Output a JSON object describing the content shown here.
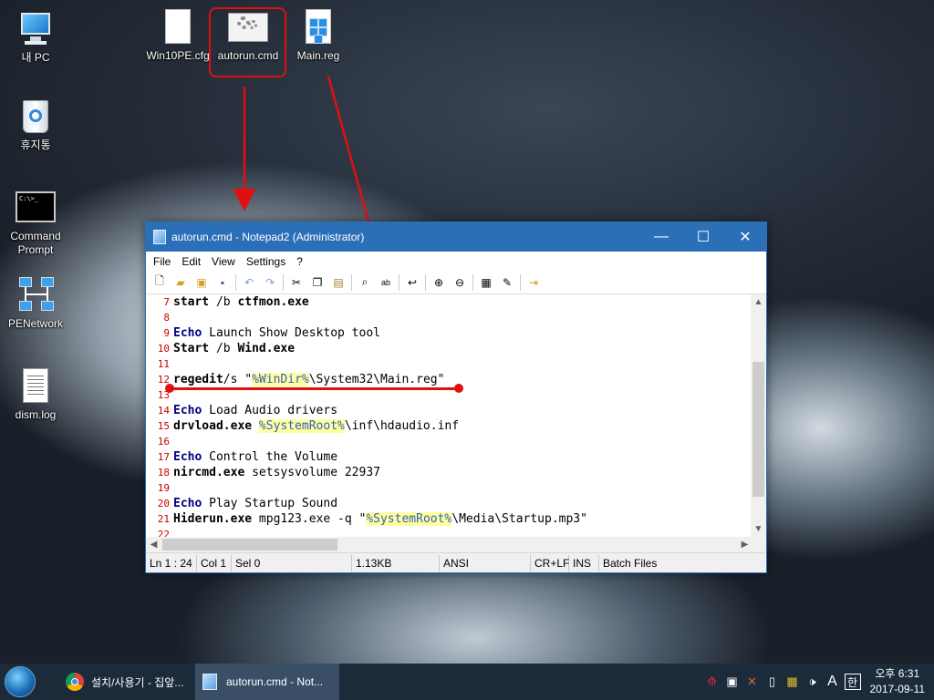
{
  "desktop": {
    "icons": [
      {
        "label": "내 PC"
      },
      {
        "label": "휴지통"
      },
      {
        "label": "Command Prompt"
      },
      {
        "label": "PENetwork"
      },
      {
        "label": "dism.log"
      },
      {
        "label": "Win10PE.cfg"
      },
      {
        "label": "autorun.cmd"
      },
      {
        "label": "Main.reg"
      }
    ]
  },
  "window": {
    "title": "autorun.cmd - Notepad2 (Administrator)",
    "menu": [
      "File",
      "Edit",
      "View",
      "Settings",
      "?"
    ],
    "lines": [
      {
        "n": "7",
        "parts": [
          {
            "t": "start",
            "c": "kw"
          },
          {
            "t": " /b ",
            "c": "code"
          },
          {
            "t": "ctfmon.exe",
            "c": "kw"
          }
        ]
      },
      {
        "n": "8",
        "parts": []
      },
      {
        "n": "9",
        "parts": [
          {
            "t": "Echo",
            "c": "echo"
          },
          {
            "t": " Launch Show Desktop tool",
            "c": "code"
          }
        ]
      },
      {
        "n": "10",
        "parts": [
          {
            "t": "Start",
            "c": "kw"
          },
          {
            "t": " /b ",
            "c": "code"
          },
          {
            "t": "Wind.exe",
            "c": "kw"
          }
        ]
      },
      {
        "n": "11",
        "parts": []
      },
      {
        "n": "12",
        "parts": [
          {
            "t": "regedit",
            "c": "kw"
          },
          {
            "t": "/s \"",
            "c": "code"
          },
          {
            "t": "%WinDir%",
            "c": "var"
          },
          {
            "t": "\\System32\\Main.reg\"",
            "c": "code"
          }
        ]
      },
      {
        "n": "13",
        "parts": []
      },
      {
        "n": "14",
        "parts": [
          {
            "t": "Echo",
            "c": "echo"
          },
          {
            "t": " Load Audio drivers",
            "c": "code"
          }
        ]
      },
      {
        "n": "15",
        "parts": [
          {
            "t": "drvload.exe",
            "c": "kw"
          },
          {
            "t": " ",
            "c": "code"
          },
          {
            "t": "%SystemRoot%",
            "c": "var"
          },
          {
            "t": "\\inf\\hdaudio.inf",
            "c": "code"
          }
        ]
      },
      {
        "n": "16",
        "parts": []
      },
      {
        "n": "17",
        "parts": [
          {
            "t": "Echo",
            "c": "echo"
          },
          {
            "t": " Control the Volume",
            "c": "code"
          }
        ]
      },
      {
        "n": "18",
        "parts": [
          {
            "t": "nircmd.exe",
            "c": "kw"
          },
          {
            "t": " setsysvolume 22937",
            "c": "code"
          }
        ]
      },
      {
        "n": "19",
        "parts": []
      },
      {
        "n": "20",
        "parts": [
          {
            "t": "Echo",
            "c": "echo"
          },
          {
            "t": " Play Startup Sound",
            "c": "code"
          }
        ]
      },
      {
        "n": "21",
        "parts": [
          {
            "t": "Hiderun.exe",
            "c": "kw"
          },
          {
            "t": " mpg123.exe -q \"",
            "c": "code"
          },
          {
            "t": "%SystemRoot%",
            "c": "var"
          },
          {
            "t": "\\Media\\Startup.mp3\"",
            "c": "code"
          }
        ]
      },
      {
        "n": "22",
        "parts": []
      }
    ],
    "status": {
      "pos": "Ln 1 : 24",
      "col": "Col 1",
      "sel": "Sel 0",
      "size": "1.13KB",
      "encoding": "ANSI",
      "eol": "CR+LF",
      "mode": "INS",
      "lexer": "Batch Files"
    }
  },
  "taskbar": {
    "items": [
      {
        "label": "설치/사용기 - 집앞..."
      },
      {
        "label": "autorun.cmd - Not..."
      }
    ],
    "clock": {
      "time": "오후 6:31",
      "date": "2017-09-11"
    },
    "ime": "A",
    "ime2": "한"
  },
  "colors": {
    "titlebar": "#2b6fb8",
    "annotation": "#e01010",
    "line_number": "#cc0000"
  }
}
